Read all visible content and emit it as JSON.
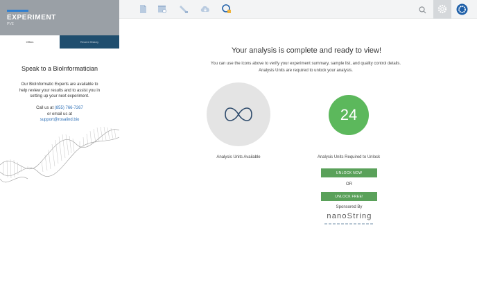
{
  "experiment": {
    "title": "EXPERIMENT",
    "subtitle": "PVE"
  },
  "tabs": [
    {
      "label": "Offers"
    },
    {
      "label": "Recent History"
    }
  ],
  "sidebar": {
    "heading": "Speak to a BioInformatician",
    "body": "Our BioInformatic Experts are available to help review your results and to assist you in setting up your next experiment.",
    "call_prefix": "Call us at",
    "phone": "(855) 766-7267",
    "email_prefix": "or email us at",
    "email": "support@rosalind.bio"
  },
  "toolbar": {
    "icons": [
      "document-icon",
      "calendar-search-icon",
      "flask-icon",
      "cloud-download-icon",
      "analysis-lock-icon"
    ],
    "search_icon": "search-icon",
    "settings_icon": "gear-icon",
    "account_icon": "badge-icon",
    "accent_color": "#1e5fa8"
  },
  "main": {
    "title": "Your analysis is complete and ready to view!",
    "description": "You can use the icons above to verify your experiment summary, sample list, and quality control details. Analysis Units are required to unlock your analysis.",
    "available_value": "∞",
    "available_label": "Analysis Units Available",
    "required_value": "24",
    "required_label": "Analysis Units Required to Unlock",
    "unlock_now_label": "UNLOCK NOW",
    "or_label": "OR",
    "unlock_free_label": "UNLOCK FREE!",
    "sponsored_by": "Sponsored By",
    "sponsor_name": "nanoString"
  }
}
